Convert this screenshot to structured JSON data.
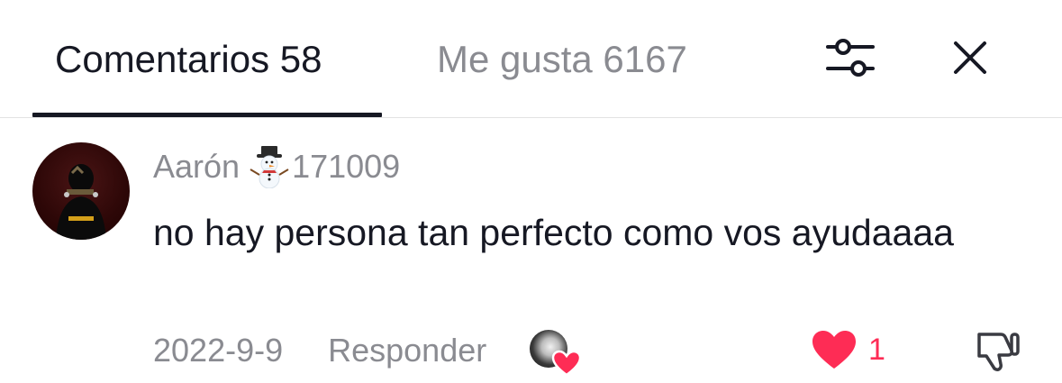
{
  "header": {
    "tabs": [
      {
        "label": "Comentarios 58",
        "active": true
      },
      {
        "label": "Me gusta 6167",
        "active": false
      }
    ],
    "filter_icon": "sliders-icon",
    "close_icon": "close-icon"
  },
  "comment": {
    "username": "Aarón",
    "username_emoji": "☃️",
    "username_suffix": "171009",
    "text": "no hay persona tan perfecto como vos ayudaaaa",
    "date": "2022-9-9",
    "reply_label": "Responder",
    "like_count": "1",
    "liked": true,
    "liked_by_creator": true
  },
  "colors": {
    "text_primary": "#161823",
    "text_secondary": "#8a8b91",
    "like_red": "#fe2c55",
    "divider": "#e3e3e3"
  }
}
